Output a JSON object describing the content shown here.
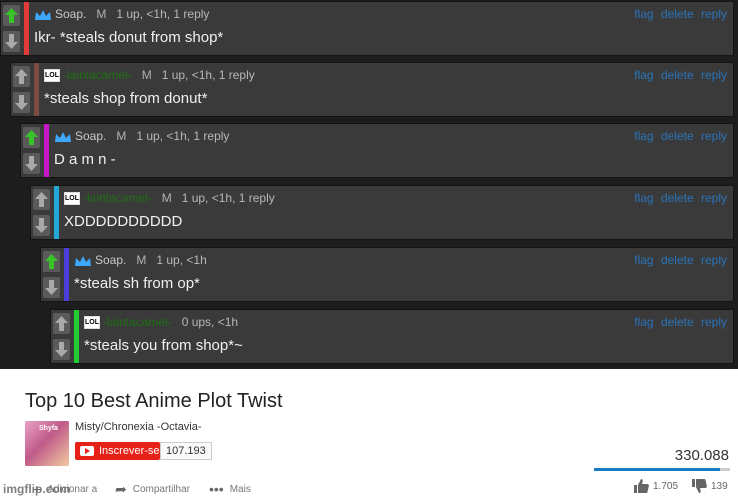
{
  "thread": {
    "actions": {
      "flag": "flag",
      "delete": "delete",
      "reply": "reply"
    },
    "comments": [
      {
        "user": "Soap.",
        "gender": "M",
        "meta": "1 up, <1h, 1 reply",
        "text": "Ikr- *steals donut from shop*",
        "bar_color": "#e23a3a",
        "upvoted": true
      },
      {
        "user": "-laintacamel-",
        "gender": "M",
        "meta": "1 up, <1h, 1 reply",
        "text": "*steals shop from donut*",
        "bar_color": "#7d4a44",
        "upvoted": false
      },
      {
        "user": "Soap.",
        "gender": "M",
        "meta": "1 up, <1h, 1 reply",
        "text": "D a m n -",
        "bar_color": "#c617c6",
        "upvoted": true
      },
      {
        "user": "-laintacamel-",
        "gender": "M",
        "meta": "1 up, <1h, 1 reply",
        "text": "XDDDDDDDDDD",
        "bar_color": "#22a7d6",
        "upvoted": false
      },
      {
        "user": "Soap.",
        "gender": "M",
        "meta": "1 up, <1h",
        "text": "*steals sh from op*",
        "bar_color": "#4a3fdc",
        "upvoted": true
      },
      {
        "user": "-laintacamel-",
        "gender": "",
        "meta": "0 ups, <1h",
        "text": "*steals you from shop*~",
        "bar_color": "#22cc33",
        "upvoted": false
      }
    ],
    "avatar_lol_text": "LOL",
    "colors": {
      "upvote_arrow": "#38c428",
      "neutral_arrow": "#a9a9a9",
      "link": "#2a73b8"
    }
  },
  "video": {
    "title": "Top 10 Best Anime Plot Twist",
    "channel_name": "Misty/Chronexia -Octavia-",
    "channel_thumb_text": "Shyfa",
    "subscribe_label": "Inscrever-se",
    "subscriber_count": "107.193",
    "views": "330.088",
    "like_ratio": 0.925,
    "actions": {
      "add_to": "Adicionar a",
      "share": "Compartilhar",
      "more": "Mais"
    },
    "likes": "1.705",
    "dislikes": "139"
  },
  "watermark": "imgflip.com"
}
